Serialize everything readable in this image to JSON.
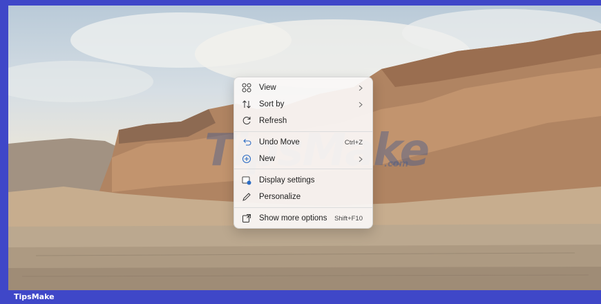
{
  "desktop": {
    "watermark_main": "TipsMake",
    "watermark_suffix": ".com"
  },
  "context_menu": {
    "items": [
      {
        "label": "View",
        "icon": "view-grid-icon",
        "has_submenu": true,
        "shortcut": ""
      },
      {
        "label": "Sort by",
        "icon": "sort-icon",
        "has_submenu": true,
        "shortcut": ""
      },
      {
        "label": "Refresh",
        "icon": "refresh-icon",
        "has_submenu": false,
        "shortcut": ""
      },
      {
        "label": "Undo Move",
        "icon": "undo-icon",
        "has_submenu": false,
        "shortcut": "Ctrl+Z"
      },
      {
        "label": "New",
        "icon": "new-plus-icon",
        "has_submenu": true,
        "shortcut": ""
      },
      {
        "label": "Display settings",
        "icon": "display-settings-icon",
        "has_submenu": false,
        "shortcut": ""
      },
      {
        "label": "Personalize",
        "icon": "pen-icon",
        "has_submenu": false,
        "shortcut": ""
      },
      {
        "label": "Show more options",
        "icon": "more-options-icon",
        "has_submenu": false,
        "shortcut": "Shift+F10"
      }
    ]
  },
  "footer": {
    "brand": "TipsMake"
  },
  "colors": {
    "frame": "#3f47c8",
    "menu_bg": "#faf8f6",
    "accent_blue": "#2b6cc4"
  }
}
